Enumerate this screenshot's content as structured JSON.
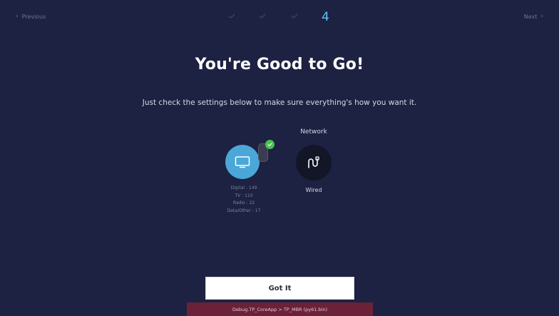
{
  "nav": {
    "previous_label": "Previous",
    "next_label": "Next"
  },
  "steps": {
    "completed_count": 3,
    "current": "4"
  },
  "title": "You're Good to Go!",
  "subtitle": "Just check the settings below to make sure everything's how you want it.",
  "channels": {
    "icon": "tv-icon",
    "status_icon": "check-icon",
    "stats": [
      "Digital : 149",
      "TV : 110",
      "Radio : 22",
      "Data/Other : 17"
    ]
  },
  "network": {
    "label": "Network",
    "icon": "ethernet-cable-icon",
    "value": "Wired"
  },
  "action": {
    "got_it_label": "Got It"
  },
  "debug": {
    "text": "Debug.TP_CoreApp > TP_MBR (py61.bin)"
  },
  "colors": {
    "background": "#1d2142",
    "accent": "#5bc2f0",
    "tv_circle": "#4aa7d8",
    "check_badge": "#49c253",
    "debug_bar": "#6b2238"
  }
}
